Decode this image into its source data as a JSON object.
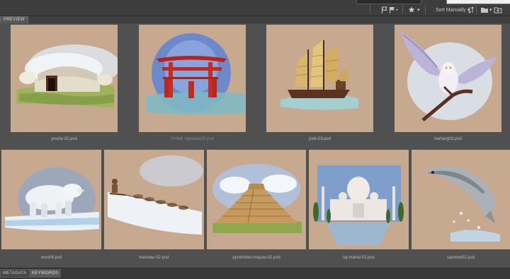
{
  "panel": {
    "tab": "PREVIEW"
  },
  "toolbar": {
    "sort_label": "Sort Manually",
    "sort_arrow": "▾",
    "star_arrow": "▾",
    "filter_arrow": "▾",
    "folder_arrow": "▾",
    "icons": [
      "flag-icon",
      "flag-menu-icon",
      "star-filter-icon",
      "folder-icon",
      "new-folder-icon"
    ]
  },
  "thumbnails": [
    {
      "file": "yourte-02.psd",
      "subject": "yurt"
    },
    {
      "file": "Portail Japonais02.psd",
      "subject": "torii"
    },
    {
      "file": "jonk-03.psd",
      "subject": "junk-ship"
    },
    {
      "file": "harfang03.psd",
      "subject": "snowy-owl"
    },
    {
      "file": "ours04.psd",
      "subject": "polar-bear"
    },
    {
      "file": "traineau-02.psd",
      "subject": "dog-sled"
    },
    {
      "file": "pyramides-mayas-02.psd",
      "subject": "mayan-pyramid"
    },
    {
      "file": "taj-mahal-02.psd",
      "subject": "taj-mahal"
    },
    {
      "file": "saumon02.psd",
      "subject": "salmon"
    }
  ],
  "bottom_tabs": [
    {
      "label": "METADATA",
      "active": false
    },
    {
      "label": "KEYWORDS",
      "active": true
    }
  ],
  "colors": {
    "thumb_bg": "#c7a990",
    "panel_bg": "#505050",
    "toolbar_bg": "#3d3d3d"
  }
}
